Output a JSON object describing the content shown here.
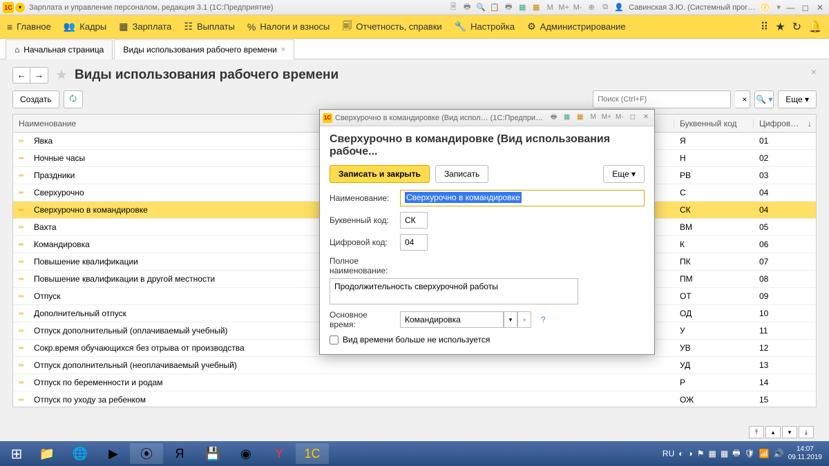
{
  "titlebar": {
    "title": "Зарплата и управление персоналом, редакция 3.1   (1С:Предприятие)",
    "user": "Савинская З.Ю. (Системный прог…",
    "m": "M",
    "mplus": "M+",
    "mminus": "M-"
  },
  "menu": {
    "items": [
      {
        "icon": "≡",
        "label": "Главное"
      },
      {
        "icon": "👥",
        "label": "Кадры"
      },
      {
        "icon": "▦",
        "label": "Зарплата"
      },
      {
        "icon": "☷",
        "label": "Выплаты"
      },
      {
        "icon": "%",
        "label": "Налоги и взносы"
      },
      {
        "icon": "🗐",
        "label": "Отчетность, справки"
      },
      {
        "icon": "🔧",
        "label": "Настройка"
      },
      {
        "icon": "⚙",
        "label": "Администрирование"
      }
    ]
  },
  "tabs": {
    "home": "Начальная страница",
    "active": "Виды использования рабочего времени"
  },
  "page": {
    "title": "Виды использования рабочего времени",
    "create": "Создать",
    "search_placeholder": "Поиск (Ctrl+F)",
    "more": "Еще"
  },
  "columns": {
    "c1": "Наименование",
    "c2": "Буквенный код",
    "c3": "Цифров…"
  },
  "rows": [
    {
      "name": "Явка",
      "code": "Я",
      "num": "01"
    },
    {
      "name": "Ночные часы",
      "code": "Н",
      "num": "02"
    },
    {
      "name": "Праздники",
      "code": "РВ",
      "num": "03"
    },
    {
      "name": "Сверхурочно",
      "code": "С",
      "num": "04"
    },
    {
      "name": "Сверхурочно в командировке",
      "code": "СК",
      "num": "04",
      "sel": true
    },
    {
      "name": "Вахта",
      "code": "ВМ",
      "num": "05"
    },
    {
      "name": "Командировка",
      "code": "К",
      "num": "06"
    },
    {
      "name": "Повышение квалификации",
      "code": "ПК",
      "num": "07"
    },
    {
      "name": "Повышение квалификации в другой местности",
      "code": "ПМ",
      "num": "08"
    },
    {
      "name": "Отпуск",
      "code": "ОТ",
      "num": "09"
    },
    {
      "name": "Дополнительный отпуск",
      "code": "ОД",
      "num": "10"
    },
    {
      "name": "Отпуск дополнительный (оплачиваемый учебный)",
      "code": "У",
      "num": "11"
    },
    {
      "name": "Сокр.время обучающихся без отрыва от производства",
      "code": "УВ",
      "num": "12"
    },
    {
      "name": "Отпуск дополнительный (неоплачиваемый учебный)",
      "code": "УД",
      "num": "13"
    },
    {
      "name": "Отпуск по беременности и родам",
      "code": "Р",
      "num": "14"
    },
    {
      "name": "Отпуск по уходу за ребенком",
      "code": "ОЖ",
      "num": "15"
    }
  ],
  "dialog": {
    "wintitle": "Сверхурочно в командировке (Вид испол…   (1С:Предприятие)",
    "heading": "Сверхурочно в командировке (Вид использования рабоче...",
    "save_close": "Записать и закрыть",
    "save": "Записать",
    "more": "Еще",
    "lbl_name": "Наименование:",
    "val_name": "Сверхурочно в командировке",
    "lbl_code": "Буквенный код:",
    "val_code": "СК",
    "lbl_num": "Цифровой код:",
    "val_num": "04",
    "lbl_full": "Полное наименование:",
    "val_full": "Продолжительность сверхурочной работы",
    "lbl_base": "Основное время:",
    "val_base": "Командировка",
    "chk": "Вид времени больше не используется",
    "m": "M",
    "mplus": "M+",
    "mminus": "M-"
  },
  "taskbar": {
    "lang": "RU",
    "time": "14:07",
    "date": "09.11.2019"
  }
}
